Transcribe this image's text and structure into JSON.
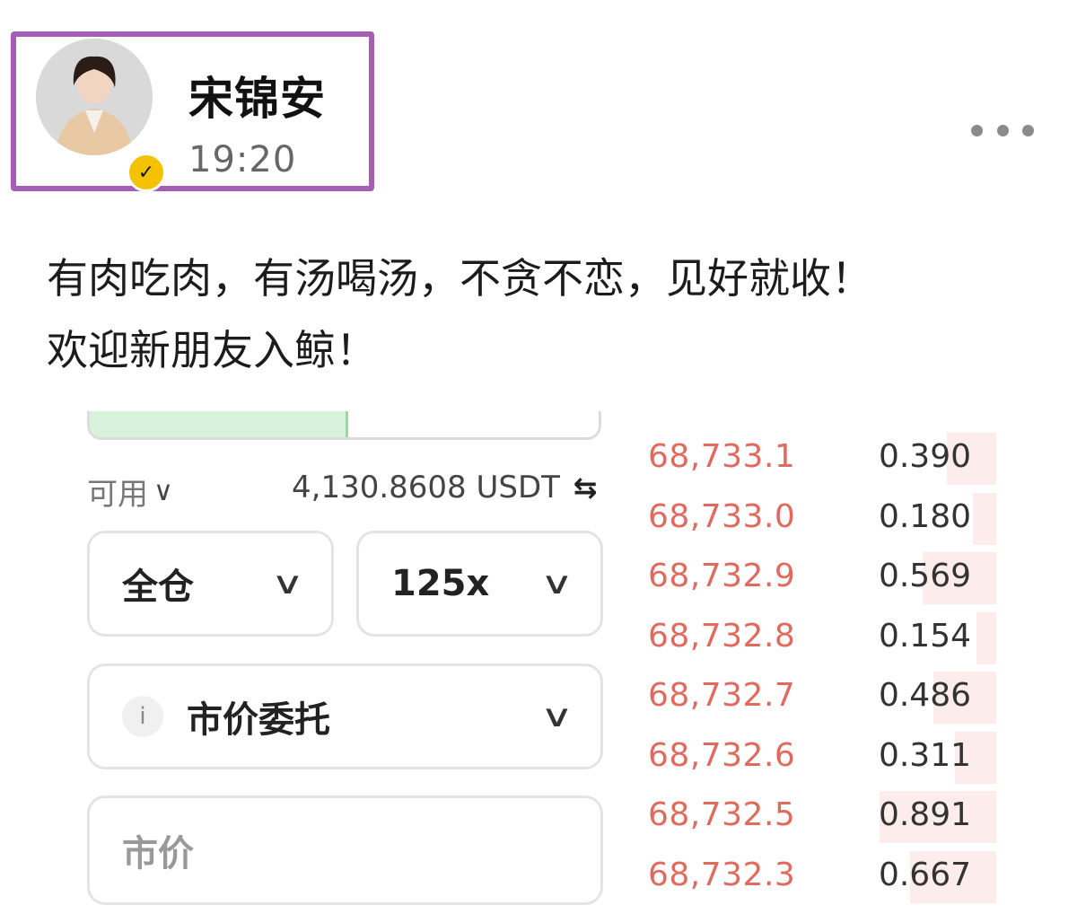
{
  "post": {
    "author_name": "宋锦安",
    "time": "19:20",
    "text_lines": [
      "有肉吃肉，有汤喝汤，不贪不恋，见好就收！",
      "欢迎新朋友入鲸！"
    ]
  },
  "icons": {
    "more": "more-horizontal-icon",
    "verified": "verified-badge-icon",
    "transfer": "transfer-icon",
    "info": "info-icon"
  },
  "colors": {
    "highlight_border": "#a45fb5",
    "verified_badge": "#f5c200",
    "ask_price": "#e06a5e",
    "ask_depth": "#fdecec",
    "buy_tab": "#d8f3dc"
  },
  "trade_panel": {
    "available_label": "可用",
    "available_value": "4,130.8608 USDT",
    "margin_mode": "全仓",
    "leverage": "125x",
    "order_type": "市价委托",
    "info_glyph": "i",
    "price_placeholder": "市价"
  },
  "order_book": {
    "asks": [
      {
        "price": "68,733.1",
        "qty": "0.390",
        "depth": 0.23
      },
      {
        "price": "68,733.0",
        "qty": "0.180",
        "depth": 0.11
      },
      {
        "price": "68,732.9",
        "qty": "0.569",
        "depth": 0.34
      },
      {
        "price": "68,732.8",
        "qty": "0.154",
        "depth": 0.09
      },
      {
        "price": "68,732.7",
        "qty": "0.486",
        "depth": 0.29
      },
      {
        "price": "68,732.6",
        "qty": "0.311",
        "depth": 0.19
      },
      {
        "price": "68,732.5",
        "qty": "0.891",
        "depth": 0.54
      },
      {
        "price": "68,732.3",
        "qty": "0.667",
        "depth": 0.4
      }
    ]
  }
}
